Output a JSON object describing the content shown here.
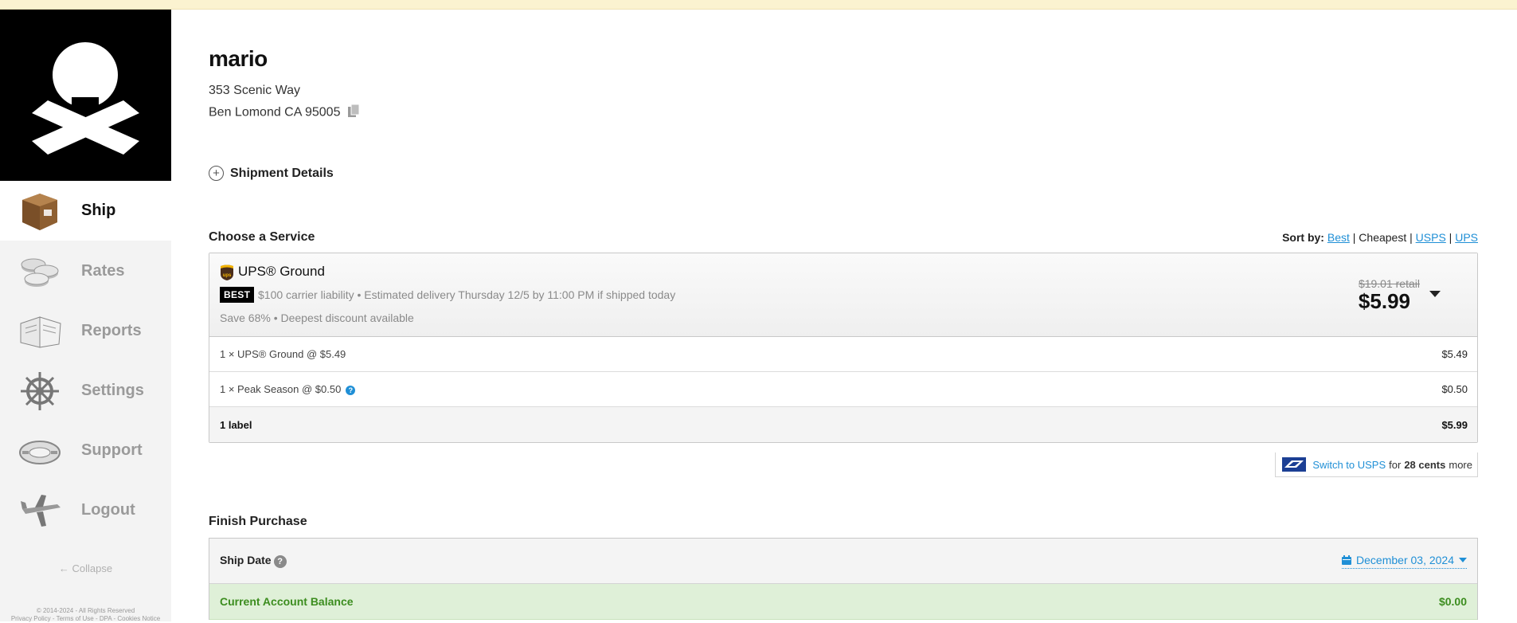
{
  "sidebar": {
    "nav": [
      {
        "label": "Ship",
        "icon": "box-icon",
        "active": true
      },
      {
        "label": "Rates",
        "icon": "coins-icon",
        "active": false
      },
      {
        "label": "Reports",
        "icon": "book-icon",
        "active": false
      },
      {
        "label": "Settings",
        "icon": "ship-wheel-icon",
        "active": false
      },
      {
        "label": "Support",
        "icon": "life-ring-icon",
        "active": false
      },
      {
        "label": "Logout",
        "icon": "airplane-icon",
        "active": false
      }
    ],
    "collapse_label": "← Collapse",
    "legal_line1": "© 2014-2024 - All Rights Reserved",
    "legal_line2": "Privacy Policy - Terms of Use - DPA - Cookies Notice"
  },
  "recipient": {
    "name": "mario",
    "address_line1": "353 Scenic Way",
    "address_line2": "Ben Lomond CA 95005"
  },
  "shipment_details_label": "Shipment Details",
  "choose_service": {
    "title": "Choose a Service",
    "sort_label": "Sort by:",
    "sort_best": "Best",
    "sort_cheapest": "Cheapest",
    "sort_usps": "USPS",
    "sort_ups": "UPS",
    "sep": "|"
  },
  "service": {
    "name": "UPS® Ground",
    "badge": "BEST",
    "meta": "$100 carrier liability • Estimated delivery Thursday 12/5 by 11:00 PM if shipped today",
    "savings": "Save 68% • Deepest discount available",
    "retail_price": "$19.01 retail",
    "price": "$5.99",
    "lines": [
      {
        "label": "1 × UPS® Ground @ $5.49",
        "amount": "$5.49"
      },
      {
        "label": "1 × Peak Season @ $0.50",
        "amount": "$0.50",
        "info": "?"
      }
    ],
    "total_label": "1 label",
    "total_amount": "$5.99"
  },
  "switch_usps": {
    "link": "Switch to USPS",
    "pre": "for",
    "amount": "28 cents",
    "post": "more"
  },
  "finish": {
    "title": "Finish Purchase",
    "ship_date_label": "Ship Date",
    "ship_date_help": "?",
    "ship_date_value": "December 03, 2024",
    "balance_label": "Current Account Balance",
    "balance_value": "$0.00"
  },
  "colors": {
    "accent": "#1f8fd6",
    "success": "#3c8d1f",
    "banner": "#fbf3d0"
  }
}
